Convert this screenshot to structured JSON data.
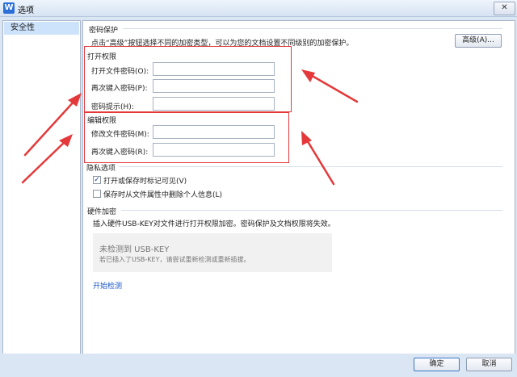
{
  "window": {
    "title": "选项",
    "app_icon_letter": "W",
    "close_glyph": "✕"
  },
  "sidebar": {
    "items": [
      {
        "label": "安全性"
      }
    ]
  },
  "password_protection": {
    "title": "密码保护",
    "description": "点击“高级”按钮选择不同的加密类型，可以为您的文档设置不同级别的加密保护。",
    "advanced_button": "高级(A)...",
    "open_perm": {
      "title": "打开权限",
      "open_password_label": "打开文件密码(O):",
      "open_password_value": "",
      "confirm_label": "再次键入密码(P):",
      "confirm_value": "",
      "hint_label": "密码提示(H):",
      "hint_value": ""
    },
    "edit_perm": {
      "title": "编辑权限",
      "modify_password_label": "修改文件密码(M):",
      "modify_password_value": "",
      "confirm_label": "再次键入密码(R):",
      "confirm_value": ""
    }
  },
  "privacy": {
    "title": "隐私选项",
    "opt1": {
      "label": "打开或保存时标记可见(V)",
      "checked": true
    },
    "opt2": {
      "label": "保存时从文件属性中删除个人信息(L)",
      "checked": false
    }
  },
  "hardware": {
    "title": "硬件加密",
    "description": "插入硬件USB-KEY对文件进行打开权限加密。密码保护及文档权限将失效。",
    "status_title": "未检测到 USB-KEY",
    "status_hint": "若已插入了USB-KEY，请尝试重新检测或重新插拔。",
    "start_link": "开始检测"
  },
  "footer": {
    "ok_label": "确定",
    "cancel_label": "取消"
  },
  "colors": {
    "annotation_red": "#e4393a",
    "link_blue": "#1a56c8",
    "selection": "#cde3fb"
  }
}
